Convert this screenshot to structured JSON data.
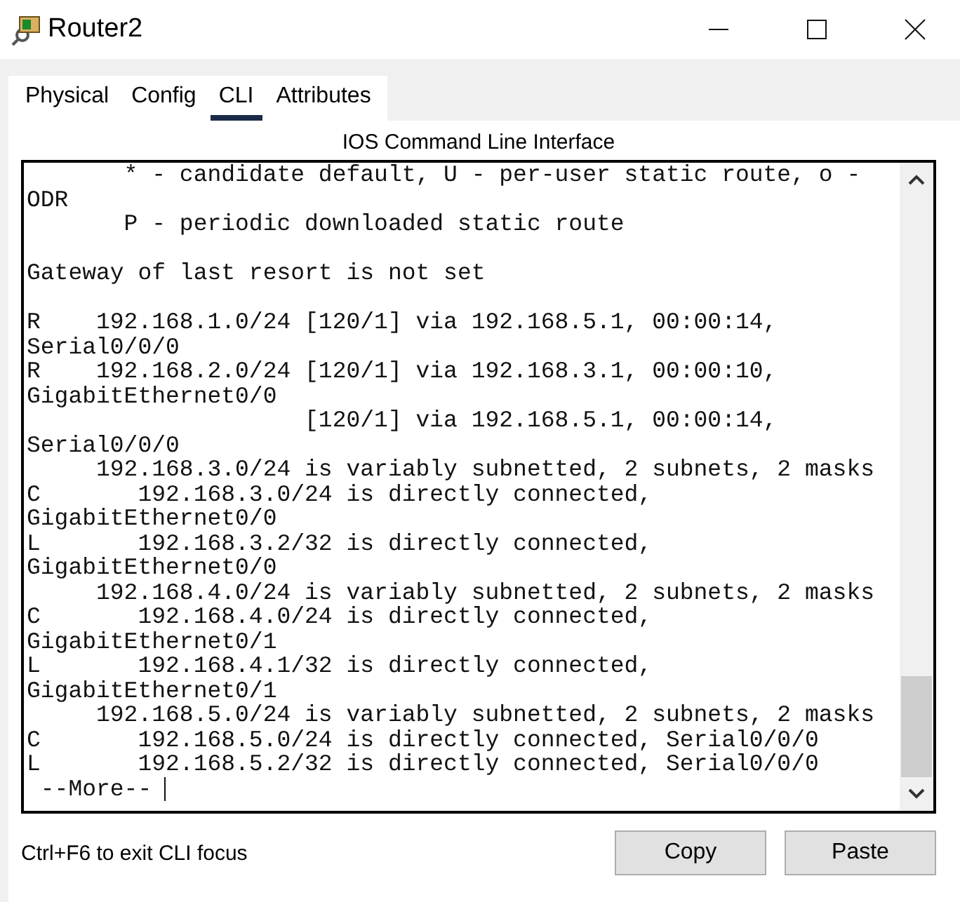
{
  "window": {
    "title": "Router2"
  },
  "tabs": [
    {
      "label": "Physical",
      "selected": false
    },
    {
      "label": "Config",
      "selected": false
    },
    {
      "label": "CLI",
      "selected": true
    },
    {
      "label": "Attributes",
      "selected": false
    }
  ],
  "panel_title": "IOS Command Line Interface",
  "cli": {
    "lines": [
      {
        "text": "       * - candidate default, U - per-user static route, o -",
        "gap_before": false
      },
      {
        "text": "ODR",
        "gap_before": false
      },
      {
        "text": "       P - periodic downloaded static route",
        "gap_before": false
      },
      {
        "text": "Gateway of last resort is not set",
        "gap_before": true
      },
      {
        "text": "R    192.168.1.0/24 [120/1] via 192.168.5.1, 00:00:14,",
        "gap_before": true
      },
      {
        "text": "Serial0/0/0",
        "gap_before": false
      },
      {
        "text": "R    192.168.2.0/24 [120/1] via 192.168.3.1, 00:00:10,",
        "gap_before": false
      },
      {
        "text": "GigabitEthernet0/0",
        "gap_before": false
      },
      {
        "text": "                    [120/1] via 192.168.5.1, 00:00:14,",
        "gap_before": false
      },
      {
        "text": "Serial0/0/0",
        "gap_before": false
      },
      {
        "text": "     192.168.3.0/24 is variably subnetted, 2 subnets, 2 masks",
        "gap_before": false
      },
      {
        "text": "C       192.168.3.0/24 is directly connected,",
        "gap_before": false
      },
      {
        "text": "GigabitEthernet0/0",
        "gap_before": false
      },
      {
        "text": "L       192.168.3.2/32 is directly connected,",
        "gap_before": false
      },
      {
        "text": "GigabitEthernet0/0",
        "gap_before": false
      },
      {
        "text": "     192.168.4.0/24 is variably subnetted, 2 subnets, 2 masks",
        "gap_before": false
      },
      {
        "text": "C       192.168.4.0/24 is directly connected,",
        "gap_before": false
      },
      {
        "text": "GigabitEthernet0/1",
        "gap_before": false
      },
      {
        "text": "L       192.168.4.1/32 is directly connected,",
        "gap_before": false
      },
      {
        "text": "GigabitEthernet0/1",
        "gap_before": false
      },
      {
        "text": "     192.168.5.0/24 is variably subnetted, 2 subnets, 2 masks",
        "gap_before": false
      },
      {
        "text": "C       192.168.5.0/24 is directly connected, Serial0/0/0",
        "gap_before": false
      },
      {
        "text": "L       192.168.5.2/32 is directly connected, Serial0/0/0",
        "gap_before": false
      }
    ],
    "prompt": " --More--"
  },
  "hint": "Ctrl+F6 to exit CLI focus",
  "buttons": [
    "Copy",
    "Paste"
  ]
}
